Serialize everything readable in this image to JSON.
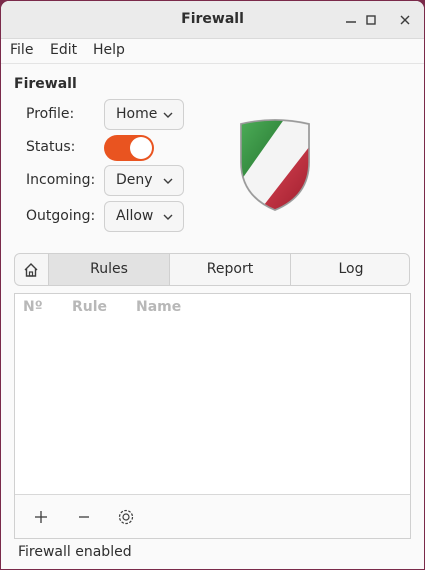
{
  "window": {
    "title": "Firewall",
    "controls": [
      "minimize-icon",
      "maximize-icon",
      "close-icon"
    ]
  },
  "menubar": {
    "items": [
      "File",
      "Edit",
      "Help"
    ]
  },
  "section_title": "Firewall",
  "settings": {
    "profile": {
      "label": "Profile:",
      "value": "Home"
    },
    "status": {
      "label": "Status:",
      "enabled": true
    },
    "incoming": {
      "label": "Incoming:",
      "value": "Deny"
    },
    "outgoing": {
      "label": "Outgoing:",
      "value": "Allow"
    }
  },
  "colors": {
    "accent": "#e95420",
    "shield_green": "#2f8a3a",
    "shield_red": "#c0283a"
  },
  "tabs": {
    "home_icon": "home-icon",
    "items": [
      "Rules",
      "Report",
      "Log"
    ],
    "active": "Rules"
  },
  "rules_table": {
    "columns": [
      "Nº",
      "Rule",
      "Name"
    ],
    "rows": []
  },
  "toolbar": {
    "icons": [
      "add-icon",
      "remove-icon",
      "settings-icon"
    ]
  },
  "status_text": "Firewall enabled"
}
